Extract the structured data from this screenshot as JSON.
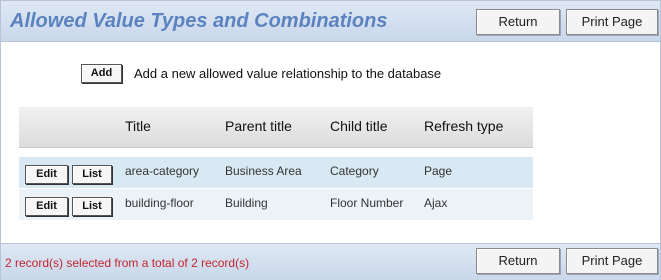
{
  "header": {
    "title": "Allowed Value Types and Combinations",
    "return_label": "Return",
    "print_label": "Print Page"
  },
  "add_section": {
    "add_label": "Add",
    "description": "Add a new allowed value relationship to the database"
  },
  "table": {
    "columns": [
      "Title",
      "Parent title",
      "Child title",
      "Refresh type"
    ],
    "rows": [
      {
        "edit_label": "Edit",
        "list_label": "List",
        "title": "area-category",
        "parent_title": "Business Area",
        "child_title": "Category",
        "refresh_type": "Page"
      },
      {
        "edit_label": "Edit",
        "list_label": "List",
        "title": "building-floor",
        "parent_title": "Building",
        "child_title": "Floor Number",
        "refresh_type": "Ajax"
      }
    ]
  },
  "footer": {
    "status": "2 record(s) selected from a total of 2 record(s)",
    "return_label": "Return",
    "print_label": "Print Page"
  },
  "colors": {
    "title": "#5b83c0",
    "header_bg": "#c9d7ea",
    "row_1_bg": "#d9e9f3",
    "row_2_bg": "#ecf3f8",
    "status_text": "#c0272d"
  }
}
